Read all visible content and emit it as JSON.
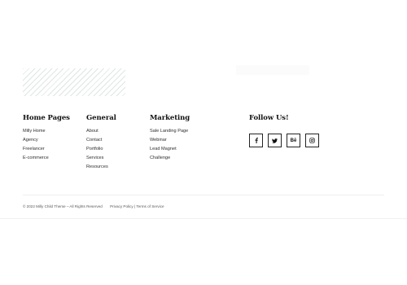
{
  "footer": {
    "columns": [
      {
        "title": "Home Pages",
        "items": [
          "Milly Home",
          "Agency",
          "Freelancer",
          "E-commerce"
        ]
      },
      {
        "title": "General",
        "items": [
          "About",
          "Contact",
          "Portfolio",
          "Services",
          "Resources"
        ]
      },
      {
        "title": "Marketing",
        "items": [
          "Sale Landing Page",
          "Webinar",
          "Lead Magnet",
          "Challenge"
        ]
      }
    ],
    "follow": {
      "title": "Follow Us!",
      "icons": [
        "facebook-icon",
        "twitter-icon",
        "behance-icon",
        "instagram-icon"
      ],
      "behance_text": "Bē"
    }
  },
  "bottom_bar": {
    "copyright": "© 2022 Milly Child Theme – All Rights Reserved",
    "privacy": "Privacy Policy",
    "separator": "|",
    "terms": "Terms of Service"
  }
}
